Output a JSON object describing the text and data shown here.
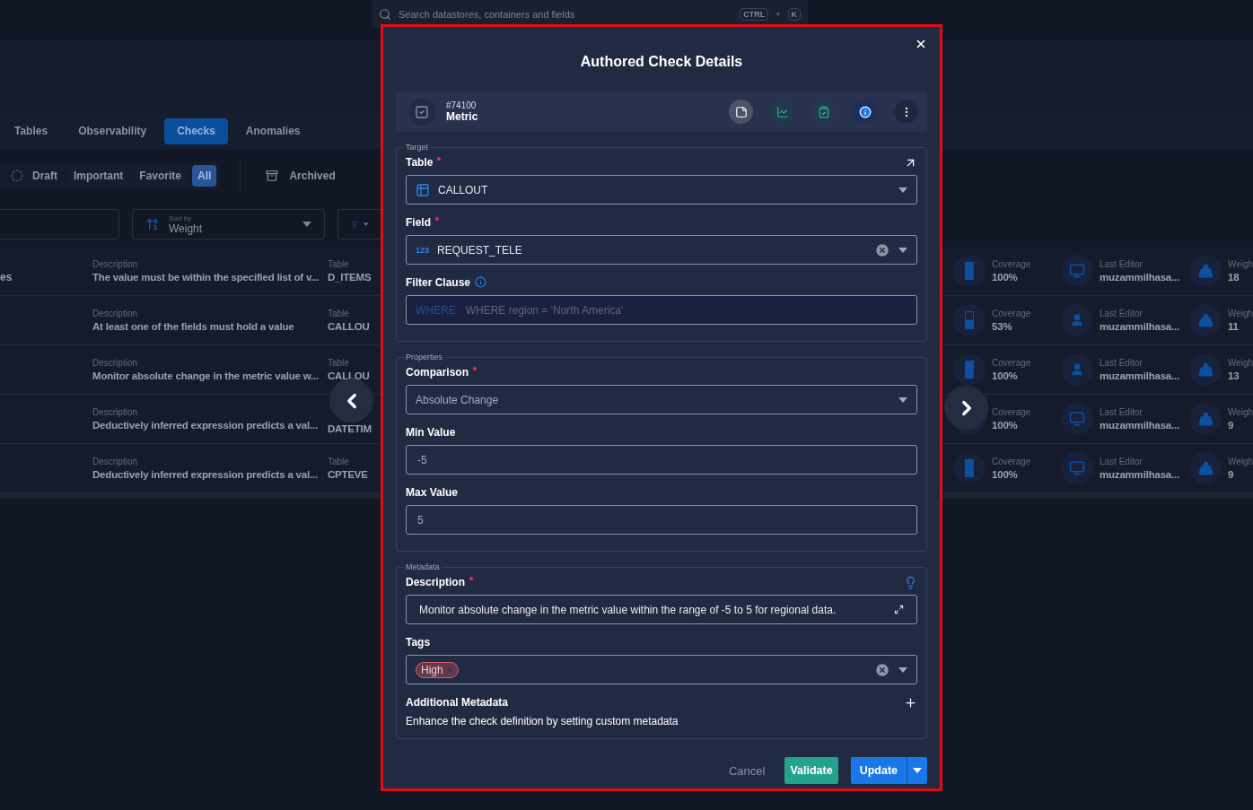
{
  "search": {
    "placeholder": "Search datastores, containers and fields",
    "keys": [
      "CTRL",
      "+",
      "K"
    ]
  },
  "tabs": [
    {
      "label": "Tables",
      "selected": false
    },
    {
      "label": "Observability",
      "selected": false
    },
    {
      "label": "Checks",
      "selected": true
    },
    {
      "label": "Anomalies",
      "selected": false
    }
  ],
  "filters": [
    {
      "label": "Draft",
      "kind": "status",
      "selected": false
    },
    {
      "label": "Important",
      "kind": "plain",
      "selected": false
    },
    {
      "label": "Favorite",
      "kind": "plain",
      "selected": false
    },
    {
      "label": "All",
      "kind": "plain",
      "selected": true
    }
  ],
  "archived": "Archived",
  "sort": {
    "label": "Sort by",
    "value": "Weight"
  },
  "rows": [
    {
      "name": "es",
      "description_label": "Description",
      "description": "The value must be within the specified list of v...",
      "table_label": "Table",
      "table": "D_ITEMS",
      "coverage_label": "Coverage",
      "coverage": "100%",
      "level": 1,
      "editor_label": "Last Editor",
      "editor": "muzammilhasa...",
      "kind": "monitor",
      "weight_label": "Weigh",
      "weight": "18"
    },
    {
      "description_label": "Description",
      "description": "At least one of the fields must hold a value",
      "table_label": "Table",
      "table": "CALLOU",
      "coverage_label": "Coverage",
      "coverage": "53%",
      "level": 0.53,
      "editor_label": "Last Editor",
      "editor": "muzammilhasa...",
      "kind": "person",
      "weight_label": "Weigh",
      "weight": "11"
    },
    {
      "description_label": "Description",
      "description": "Monitor absolute change in the metric value w...",
      "table_label": "Table",
      "table": "CALLOU",
      "coverage_label": "Coverage",
      "coverage": "100%",
      "level": 1,
      "editor_label": "Last Editor",
      "editor": "muzammilhasa...",
      "kind": "person",
      "weight_label": "Weigh",
      "weight": "13"
    },
    {
      "description_label": "Description",
      "description": "Deductively inferred expression predicts a val...",
      "table": "DATETIM",
      "coverage_label": "Coverage",
      "coverage": "100%",
      "level": 1,
      "editor_label": "Last Editor",
      "editor": "muzammilhasa...",
      "kind": "monitor",
      "weight_label": "Weigh",
      "weight": "9"
    },
    {
      "description_label": "Description",
      "description": "Deductively inferred expression predicts a val...",
      "table_label": "Table",
      "table": "CPTEVE",
      "coverage_label": "Coverage",
      "coverage": "100%",
      "level": 1,
      "editor_label": "Last Editor",
      "editor": "muzammilhasa...",
      "kind": "monitor",
      "weight_label": "Weigh",
      "weight": "9"
    }
  ],
  "modal": {
    "title": "Authored Check Details",
    "check": {
      "id": "#74100",
      "type": "Metric"
    },
    "actions": [
      {
        "kind": "note",
        "selected": true
      },
      {
        "kind": "chart",
        "selected": false
      },
      {
        "kind": "clipboard",
        "selected": false
      },
      {
        "kind": "info",
        "selected": false
      },
      {
        "kind": "more",
        "selected": false
      }
    ],
    "sections": [
      {
        "legend": "Target",
        "fields": [
          {
            "kind": "table",
            "label": "Table",
            "required": true,
            "link": true,
            "value": "CALLOUT",
            "clearable": false
          },
          {
            "kind": "select",
            "label": "Field",
            "required": true,
            "badge": "123",
            "value": "REQUEST_TELE",
            "clearable": true
          },
          {
            "kind": "sql",
            "label": "Filter Clause",
            "info": true,
            "prefix": "WHERE",
            "placeholder": "WHERE region = 'North America'"
          }
        ]
      },
      {
        "legend": "Properties",
        "fields": [
          {
            "kind": "select",
            "label": "Comparison",
            "required": true,
            "value": "Absolute Change",
            "muted": true,
            "clearable": false
          },
          {
            "kind": "input",
            "label": "Min Value",
            "value": "-5"
          },
          {
            "kind": "input",
            "label": "Max Value",
            "value": "5"
          }
        ]
      },
      {
        "legend": "Metadata",
        "fields": [
          {
            "kind": "text",
            "label": "Description",
            "required": true,
            "hint": true,
            "value": "Monitor absolute change in the metric value within the range of -5 to 5 for regional data."
          },
          {
            "kind": "tags",
            "label": "Tags",
            "tags": [
              {
                "label": "High",
                "color": "#e05a68"
              }
            ],
            "clearable": true
          },
          {
            "kind": "extra",
            "label": "Additional Metadata",
            "text": "Enhance the check definition by setting custom metadata"
          }
        ]
      }
    ],
    "buttons": {
      "cancel": "Cancel",
      "validate": "Validate",
      "update": "Update"
    }
  }
}
